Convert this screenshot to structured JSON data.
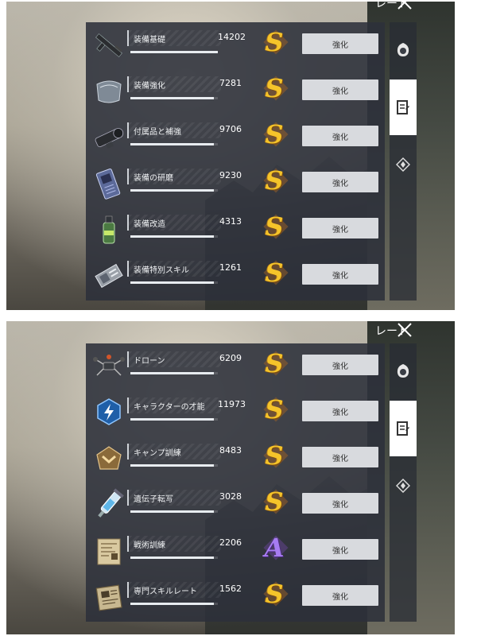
{
  "header": {
    "title": "レート"
  },
  "colors": {
    "grade_s": "#f5c42a",
    "grade_a": "#a77cf2",
    "button_bg": "#d8dade"
  },
  "panels": [
    {
      "items": [
        {
          "name": "装備基礎",
          "value": "14202",
          "grade": "S",
          "button": "強化",
          "progress": 1.0,
          "icon": "rifle-icon"
        },
        {
          "name": "装備強化",
          "value": "7281",
          "grade": "S",
          "button": "強化",
          "progress": 0.95,
          "icon": "armor-plate-icon"
        },
        {
          "name": "付属品と補強",
          "value": "9706",
          "grade": "S",
          "button": "強化",
          "progress": 0.95,
          "icon": "scope-icon"
        },
        {
          "name": "装備の研磨",
          "value": "9230",
          "grade": "S",
          "button": "強化",
          "progress": 0.95,
          "icon": "chip-icon"
        },
        {
          "name": "装備改造",
          "value": "4313",
          "grade": "S",
          "button": "強化",
          "progress": 0.95,
          "icon": "spray-can-icon"
        },
        {
          "name": "装備特別スキル",
          "value": "1261",
          "grade": "S",
          "button": "強化",
          "progress": 0.95,
          "icon": "module-icon"
        }
      ]
    },
    {
      "items": [
        {
          "name": "ドローン",
          "value": "6209",
          "grade": "S",
          "button": "強化",
          "progress": 0.95,
          "icon": "drone-icon"
        },
        {
          "name": "キャラクターの才能",
          "value": "11973",
          "grade": "S",
          "button": "強化",
          "progress": 0.95,
          "icon": "lightning-badge-icon"
        },
        {
          "name": "キャンプ訓練",
          "value": "8483",
          "grade": "S",
          "button": "強化",
          "progress": 0.95,
          "icon": "chevron-badge-icon"
        },
        {
          "name": "遺伝子転写",
          "value": "3028",
          "grade": "S",
          "button": "強化",
          "progress": 0.95,
          "icon": "syringe-icon"
        },
        {
          "name": "戦術訓練",
          "value": "2206",
          "grade": "A",
          "button": "強化",
          "progress": 0.95,
          "icon": "map-scroll-icon"
        },
        {
          "name": "専門スキルレート",
          "value": "1562",
          "grade": "S",
          "button": "強化",
          "progress": 0.95,
          "icon": "book-icon"
        }
      ]
    }
  ]
}
